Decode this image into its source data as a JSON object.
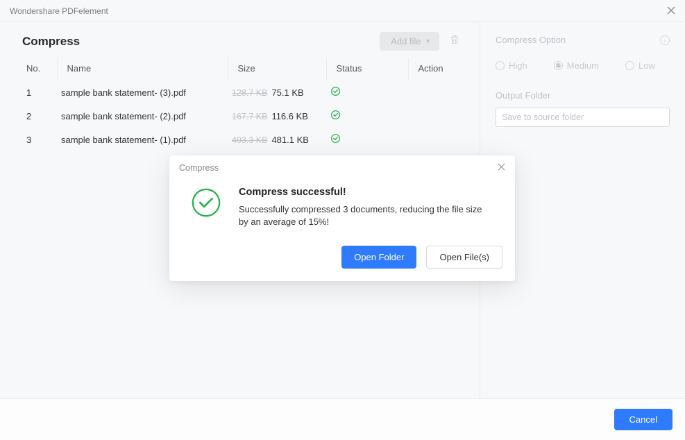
{
  "app": {
    "title": "Wondershare PDFelement"
  },
  "page": {
    "title": "Compress"
  },
  "toolbar": {
    "add_file_label": "Add file"
  },
  "table": {
    "headers": {
      "no": "No.",
      "name": "Name",
      "size": "Size",
      "status": "Status",
      "action": "Action"
    },
    "rows": [
      {
        "no": "1",
        "name": "sample bank statement- (3).pdf",
        "size_old": "128.7 KB",
        "size_new": "75.1 KB"
      },
      {
        "no": "2",
        "name": "sample bank statement- (2).pdf",
        "size_old": "167.7 KB",
        "size_new": "116.6 KB"
      },
      {
        "no": "3",
        "name": "sample bank statement- (1).pdf",
        "size_old": "493.3 KB",
        "size_new": "481.1 KB"
      }
    ]
  },
  "side": {
    "compress_option_label": "Compress Option",
    "levels": {
      "high": "High",
      "medium": "Medium",
      "low": "Low",
      "selected": "Medium"
    },
    "output_folder_label": "Output Folder",
    "output_folder_placeholder": "Save to source folder"
  },
  "dialog": {
    "title": "Compress",
    "heading": "Compress successful!",
    "message": "Successfully compressed 3 documents, reducing the file size by an average of 15%!",
    "open_folder": "Open Folder",
    "open_files": "Open File(s)"
  },
  "footer": {
    "cancel": "Cancel"
  }
}
